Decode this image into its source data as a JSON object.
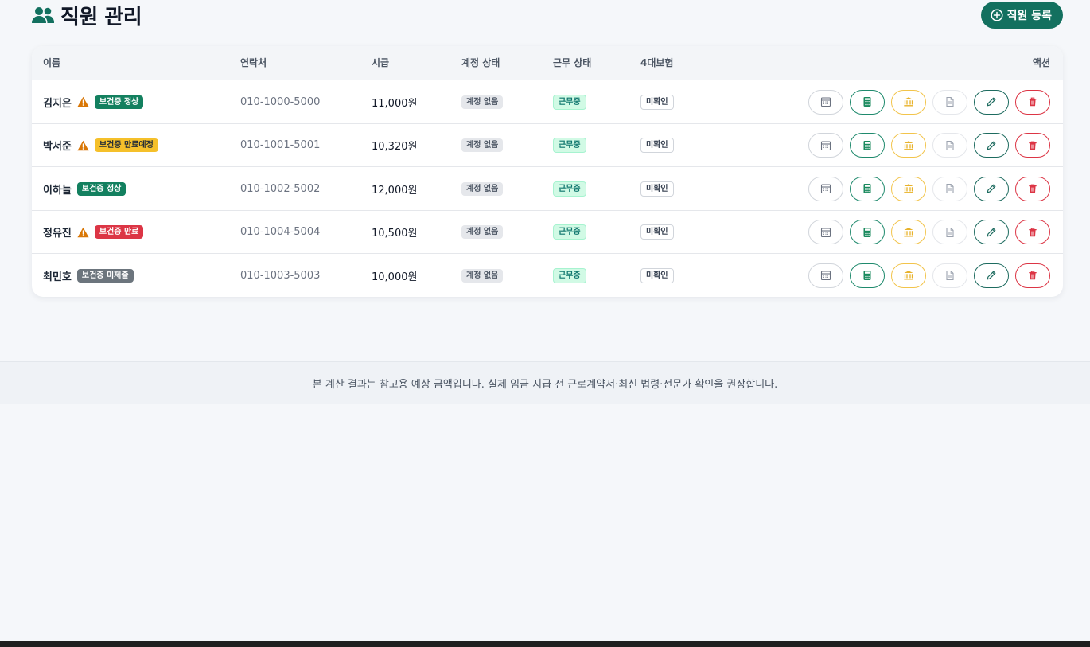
{
  "header": {
    "title": "직원 관리",
    "add_button_label": "직원 등록"
  },
  "table": {
    "columns": {
      "name": "이름",
      "phone": "연락처",
      "wage": "시급",
      "account": "계정 상태",
      "work": "근무 상태",
      "insurance": "4대보험",
      "actions": "액션"
    },
    "rows": [
      {
        "name": "김지은",
        "warning": true,
        "health_label": "보건증 정상",
        "health_status": "ok",
        "phone": "010-1000-5000",
        "wage": "11,000원",
        "account": "계정 없음",
        "work": "근무중",
        "insurance": "미확인"
      },
      {
        "name": "박서준",
        "warning": true,
        "health_label": "보건증 만료예정",
        "health_status": "soon",
        "phone": "010-1001-5001",
        "wage": "10,320원",
        "account": "계정 없음",
        "work": "근무중",
        "insurance": "미확인"
      },
      {
        "name": "이하늘",
        "warning": false,
        "health_label": "보건증 정상",
        "health_status": "ok",
        "phone": "010-1002-5002",
        "wage": "12,000원",
        "account": "계정 없음",
        "work": "근무중",
        "insurance": "미확인"
      },
      {
        "name": "정유진",
        "warning": true,
        "health_label": "보건증 만료",
        "health_status": "exp",
        "phone": "010-1004-5004",
        "wage": "10,500원",
        "account": "계정 없음",
        "work": "근무중",
        "insurance": "미확인"
      },
      {
        "name": "최민호",
        "warning": false,
        "health_label": "보건증 미제출",
        "health_status": "none",
        "phone": "010-1003-5003",
        "wage": "10,000원",
        "account": "계정 없음",
        "work": "근무중",
        "insurance": "미확인"
      }
    ],
    "action_icons": [
      "calendar-icon",
      "calculator-icon",
      "bank-icon",
      "document-icon",
      "pencil-icon",
      "trash-icon"
    ]
  },
  "footer": {
    "notice": "본 계산 결과는 참고용 예상 금액입니다. 실제 임금 지급 전 근로계약서·최신 법령·전문가 확인을 권장합니다."
  },
  "colors": {
    "brand": "#13705f",
    "health_ok": "#13805f",
    "health_soon": "#f5c02a",
    "health_expired": "#dc3545",
    "health_missing": "#6c757d",
    "warning": "#d97706"
  }
}
